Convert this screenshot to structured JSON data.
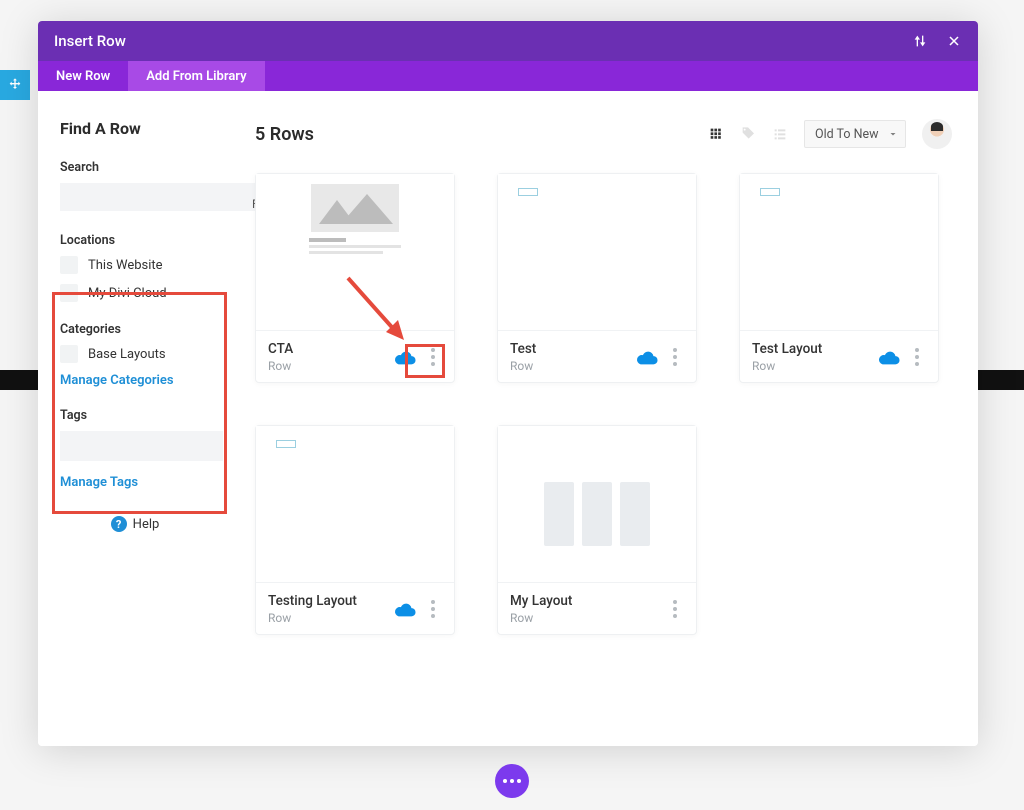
{
  "modal": {
    "title": "Insert Row",
    "tabs": [
      {
        "label": "New Row",
        "active": false
      },
      {
        "label": "Add From Library",
        "active": true
      }
    ]
  },
  "sidebar": {
    "title": "Find A Row",
    "search_label": "Search",
    "filter_button": "+ Filter",
    "locations_label": "Locations",
    "locations": [
      {
        "label": "This Website"
      },
      {
        "label": "My Divi Cloud"
      }
    ],
    "categories_label": "Categories",
    "categories": [
      {
        "label": "Base Layouts"
      }
    ],
    "manage_categories": "Manage Categories",
    "tags_label": "Tags",
    "manage_tags": "Manage Tags",
    "help_label": "Help"
  },
  "main": {
    "count_label": "5 Rows",
    "sort_value": "Old To New",
    "cards": [
      {
        "title": "CTA",
        "sub": "Row",
        "cloud": true,
        "preview": "image",
        "highlighted": true
      },
      {
        "title": "Test",
        "sub": "Row",
        "cloud": true,
        "preview": "tag"
      },
      {
        "title": "Test Layout",
        "sub": "Row",
        "cloud": true,
        "preview": "tag"
      },
      {
        "title": "Testing Layout",
        "sub": "Row",
        "cloud": true,
        "preview": "tag"
      },
      {
        "title": "My Layout",
        "sub": "Row",
        "cloud": false,
        "preview": "columns"
      }
    ]
  },
  "colors": {
    "accent_purple": "#8927d8",
    "accent_blue": "#0c8fe6",
    "highlight_red": "#e54a3c"
  }
}
